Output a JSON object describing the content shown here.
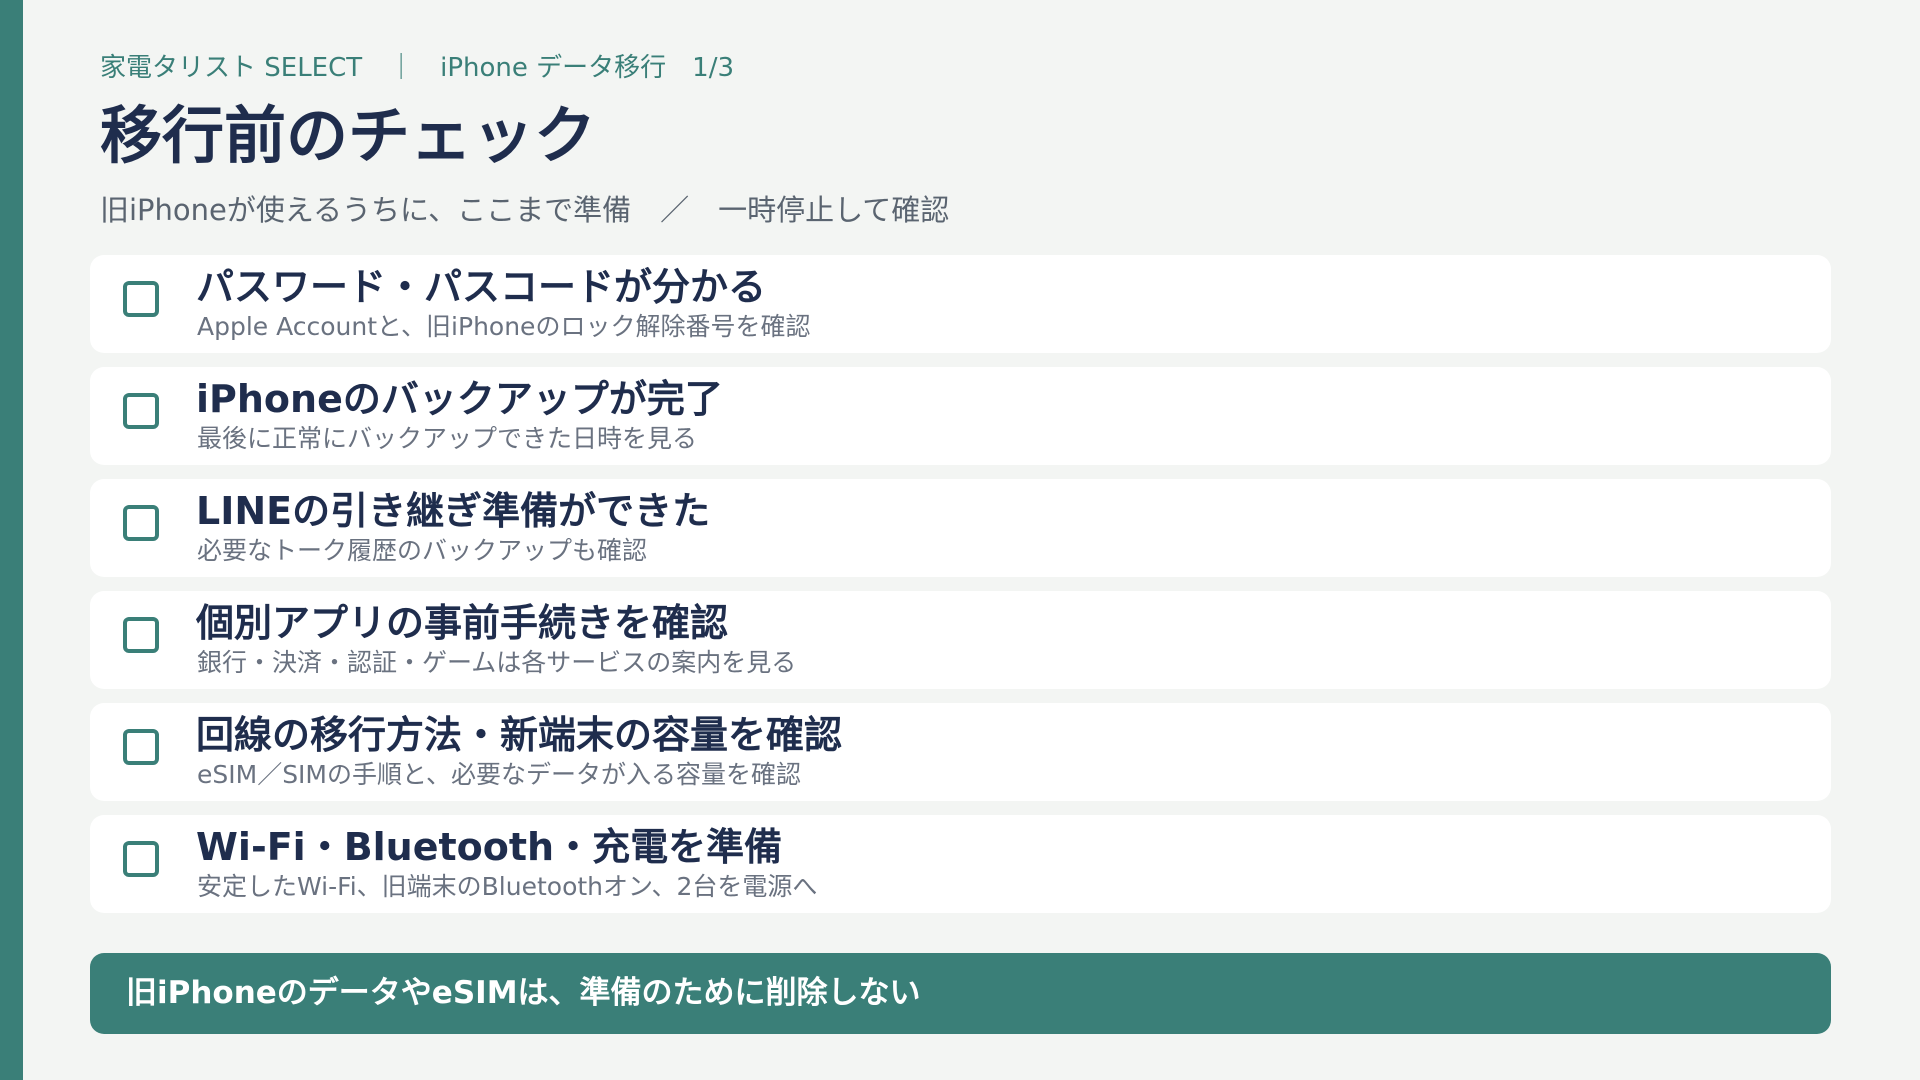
{
  "colors": {
    "accent": "#3a7f78",
    "title": "#1f2d4d",
    "background": "#f3f5f3"
  },
  "header": {
    "breadcrumb": "家電タリスト SELECT　｜　iPhone データ移行　1/3",
    "title": "移行前のチェック",
    "subtitle": "旧iPhoneが使えるうちに、ここまで準備　／　一時停止して確認"
  },
  "checklist": [
    {
      "title": "パスワード・パスコードが分かる",
      "description": "Apple Accountと、旧iPhoneのロック解除番号を確認",
      "checked": false
    },
    {
      "title": "iPhoneのバックアップが完了",
      "description": "最後に正常にバックアップできた日時を見る",
      "checked": false
    },
    {
      "title": "LINEの引き継ぎ準備ができた",
      "description": "必要なトーク履歴のバックアップも確認",
      "checked": false
    },
    {
      "title": "個別アプリの事前手続きを確認",
      "description": "銀行・決済・認証・ゲームは各サービスの案内を見る",
      "checked": false
    },
    {
      "title": "回線の移行方法・新端末の容量を確認",
      "description": "eSIM／SIMの手順と、必要なデータが入る容量を確認",
      "checked": false
    },
    {
      "title": "Wi-Fi・Bluetooth・充電を準備",
      "description": "安定したWi-Fi、旧端末のBluetoothオン、2台を電源へ",
      "checked": false
    }
  ],
  "notice": {
    "text": "旧iPhoneのデータやeSIMは、準備のために削除しない"
  }
}
